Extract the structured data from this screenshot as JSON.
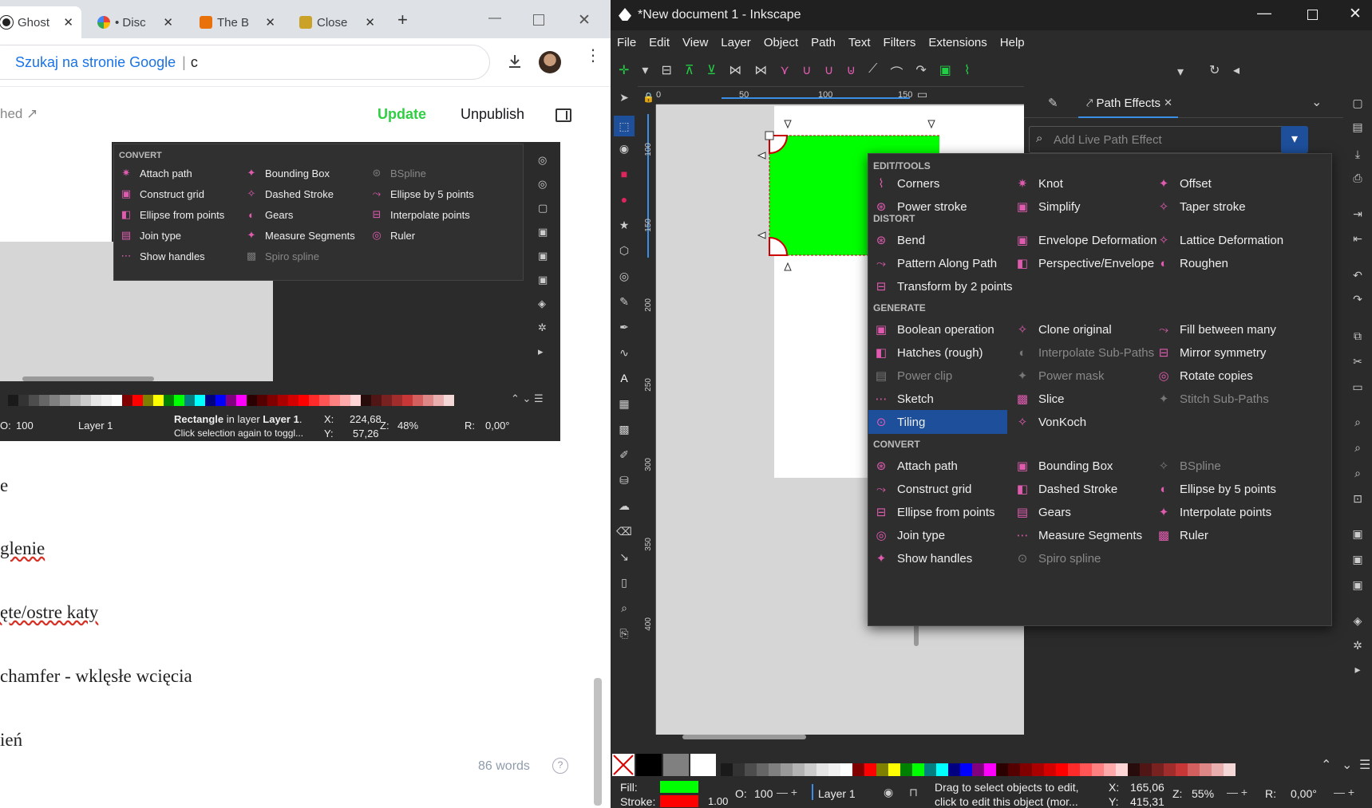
{
  "chrome": {
    "tabs": [
      {
        "label": "Ghost",
        "icon": "ghost-icon"
      },
      {
        "label": "• Disc",
        "icon": "chrome-icon"
      },
      {
        "label": "The B",
        "icon": "bo-icon"
      },
      {
        "label": "Close",
        "icon": "close-tab-icon"
      }
    ],
    "new_tab": "+",
    "omnibox_prefix": "Szukaj na stronie Google",
    "omnibox_query": "c"
  },
  "ghost": {
    "status_fragment": "hed ↗",
    "update": "Update",
    "unpublish": "Unpublish",
    "lines": [
      "e",
      "glenie",
      "ęte/ostre katy",
      "chamfer - wklęsłe wcięcia",
      "ień"
    ],
    "word_count": "86 words",
    "help": "?"
  },
  "inset": {
    "section": "CONVERT",
    "items": [
      {
        "label": "Attach path",
        "disabled": false
      },
      {
        "label": "Bounding Box",
        "disabled": false
      },
      {
        "label": "BSpline",
        "disabled": true
      },
      {
        "label": "Construct grid",
        "disabled": false
      },
      {
        "label": "Dashed Stroke",
        "disabled": false
      },
      {
        "label": "Ellipse by 5 points",
        "disabled": false
      },
      {
        "label": "Ellipse from points",
        "disabled": false
      },
      {
        "label": "Gears",
        "disabled": false
      },
      {
        "label": "Interpolate points",
        "disabled": false
      },
      {
        "label": "Join type",
        "disabled": false
      },
      {
        "label": "Measure Segments",
        "disabled": false
      },
      {
        "label": "Ruler",
        "disabled": false
      },
      {
        "label": "Show handles",
        "disabled": false
      },
      {
        "label": "Spiro spline",
        "disabled": true
      }
    ],
    "status": {
      "opacity": "100",
      "layer": "Layer 1",
      "obj": "Rectangle",
      "obj_rest": " in layer ",
      "obj_layer": "Layer 1",
      "obj_end": ".",
      "hint": "Click selection again to toggl...",
      "x_label": "X:",
      "x_val": "224,68",
      "y_label": "Y:",
      "y_val": "57,26",
      "z_label": "Z:",
      "zoom": "48%",
      "r_label": "R:",
      "rot": "0,00°",
      "o_label": "O:"
    }
  },
  "inkscape": {
    "title": "*New document 1 - Inkscape",
    "menu": [
      "File",
      "Edit",
      "View",
      "Layer",
      "Object",
      "Path",
      "Text",
      "Filters",
      "Extensions",
      "Help"
    ],
    "ruler_labels": [
      "0",
      "50",
      "100",
      "150"
    ],
    "vruler_labels": [
      "100",
      "150",
      "200",
      "250",
      "300",
      "350",
      "400"
    ],
    "dock_tab": "Path Effects",
    "search_placeholder": "Add Live Path Effect",
    "sections": {
      "edit": "EDIT/TOOLS",
      "distort": "DISTORT",
      "generate": "GENERATE",
      "convert": "CONVERT"
    },
    "edit_items": [
      {
        "label": "Corners",
        "disabled": false
      },
      {
        "label": "Knot",
        "disabled": false
      },
      {
        "label": "Offset",
        "disabled": false
      },
      {
        "label": "Power stroke",
        "disabled": false
      },
      {
        "label": "Simplify",
        "disabled": false
      },
      {
        "label": "Taper stroke",
        "disabled": false
      }
    ],
    "distort_items": [
      {
        "label": "Bend",
        "disabled": false
      },
      {
        "label": "Envelope Deformation",
        "disabled": false
      },
      {
        "label": "Lattice Deformation",
        "disabled": false
      },
      {
        "label": "Pattern Along Path",
        "disabled": false
      },
      {
        "label": "Perspective/Envelope",
        "disabled": false
      },
      {
        "label": "Roughen",
        "disabled": false
      },
      {
        "label": "Transform by 2 points",
        "disabled": false
      }
    ],
    "generate_items": [
      {
        "label": "Boolean operation",
        "disabled": false
      },
      {
        "label": "Clone original",
        "disabled": false
      },
      {
        "label": "Fill between many",
        "disabled": false
      },
      {
        "label": "Hatches (rough)",
        "disabled": false
      },
      {
        "label": "Interpolate Sub-Paths",
        "disabled": true
      },
      {
        "label": "Mirror symmetry",
        "disabled": false
      },
      {
        "label": "Power clip",
        "disabled": true
      },
      {
        "label": "Power mask",
        "disabled": true
      },
      {
        "label": "Rotate copies",
        "disabled": false
      },
      {
        "label": "Sketch",
        "disabled": false
      },
      {
        "label": "Slice",
        "disabled": false
      },
      {
        "label": "Stitch Sub-Paths",
        "disabled": true
      },
      {
        "label": "Tiling",
        "disabled": false,
        "selected": true
      },
      {
        "label": "VonKoch",
        "disabled": false
      }
    ],
    "convert_items": [
      {
        "label": "Attach path",
        "disabled": false
      },
      {
        "label": "Bounding Box",
        "disabled": false
      },
      {
        "label": "BSpline",
        "disabled": true
      },
      {
        "label": "Construct grid",
        "disabled": false
      },
      {
        "label": "Dashed Stroke",
        "disabled": false
      },
      {
        "label": "Ellipse by 5 points",
        "disabled": false
      },
      {
        "label": "Ellipse from points",
        "disabled": false
      },
      {
        "label": "Gears",
        "disabled": false
      },
      {
        "label": "Interpolate points",
        "disabled": false
      },
      {
        "label": "Join type",
        "disabled": false
      },
      {
        "label": "Measure Segments",
        "disabled": false
      },
      {
        "label": "Ruler",
        "disabled": false
      },
      {
        "label": "Show handles",
        "disabled": false
      },
      {
        "label": "Spiro spline",
        "disabled": true
      }
    ],
    "status": {
      "fill_label": "Fill:",
      "stroke_label": "Stroke:",
      "stroke_width": "1.00",
      "o_label": "O:",
      "opacity": "100",
      "layer": "Layer 1",
      "hint1": "Drag to select objects to edit,",
      "hint2": "click to edit this object (mor...",
      "x_label": "X:",
      "x_val": "165,06",
      "y_label": "Y:",
      "y_val": "415,31",
      "z_label": "Z:",
      "zoom": "55%",
      "r_label": "R:",
      "rot": "0,00°"
    },
    "colors": {
      "fill": "#00ff00",
      "stroke": "#ff0000",
      "selected": "#1d4f9b",
      "accent": "#e05bb0"
    }
  }
}
